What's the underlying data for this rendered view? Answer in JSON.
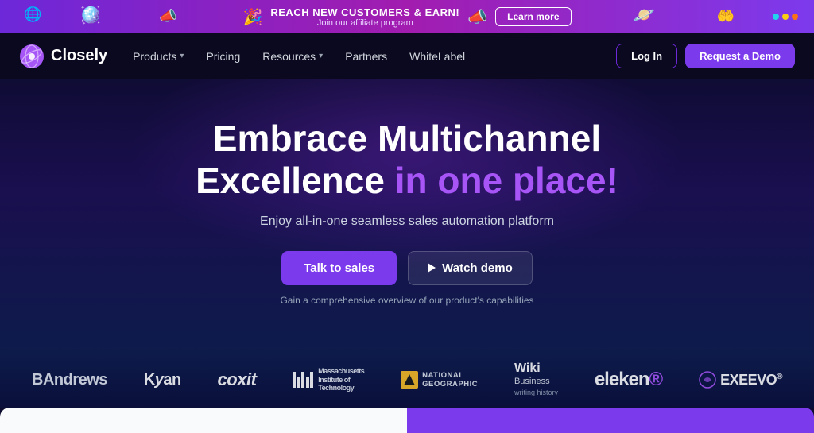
{
  "banner": {
    "title": "REACH NEW CUSTOMERS & EARN!",
    "subtitle": "Join our affiliate program",
    "learn_more_label": "Learn more",
    "emoji_left": "📣",
    "emoji_right": "🪐"
  },
  "navbar": {
    "logo_text": "Closely",
    "links": [
      {
        "label": "Products",
        "has_dropdown": true
      },
      {
        "label": "Pricing",
        "has_dropdown": false
      },
      {
        "label": "Resources",
        "has_dropdown": true
      },
      {
        "label": "Partners",
        "has_dropdown": false
      },
      {
        "label": "WhiteLabel",
        "has_dropdown": false
      }
    ],
    "login_label": "Log In",
    "demo_label": "Request a Demo"
  },
  "hero": {
    "heading_line1": "Embrace Multichannel",
    "heading_line2_normal": "Excellence ",
    "heading_line2_colored": "in one place!",
    "subheading": "Enjoy all-in-one seamless sales automation platform",
    "talk_sales_label": "Talk to sales",
    "watch_demo_label": "Watch demo",
    "caption": "Gain a comprehensive overview of our product's capabilities"
  },
  "logos": [
    {
      "id": "andrews",
      "type": "text",
      "text": "BAndrews"
    },
    {
      "id": "kyan",
      "type": "text",
      "text": "Kyan"
    },
    {
      "id": "coxit",
      "type": "text",
      "text": "coxit"
    },
    {
      "id": "mit",
      "type": "mit",
      "text": "Massachusetts Institute of Technology"
    },
    {
      "id": "ng",
      "type": "ng",
      "text1": "NATIONAL",
      "text2": "GEOGRAPHIC"
    },
    {
      "id": "wiki",
      "type": "wiki",
      "title": "Wiki",
      "subtitle1": "Business",
      "subtitle2": "writing history"
    },
    {
      "id": "eleken",
      "type": "text",
      "text": "eleken"
    },
    {
      "id": "exeevo",
      "type": "text",
      "text": "EXEEVO"
    }
  ],
  "colors": {
    "accent_purple": "#7c3aed",
    "light_purple": "#a855f7",
    "bg_dark": "#0d0b2e",
    "banner_bg": "#8b3cf7"
  }
}
